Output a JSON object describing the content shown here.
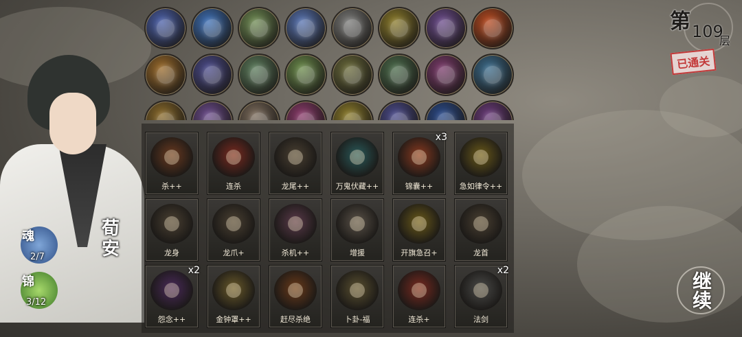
{
  "character": {
    "name": "荀安"
  },
  "stats": {
    "soul_label": "魂",
    "soul_value": "2/7",
    "bag_label": "锦",
    "bag_value": "3/12"
  },
  "floor": {
    "prefix": "第",
    "number": "109",
    "suffix": "层",
    "status": "已通关"
  },
  "continue_button": "继续",
  "relics": [
    {
      "icon": "copper-coin-icon",
      "color": "#4a5fa8"
    },
    {
      "icon": "blue-beads-icon",
      "color": "#3d6fb5"
    },
    {
      "icon": "jade-disc-icon",
      "color": "#6e8a52"
    },
    {
      "icon": "pearls-icon",
      "color": "#5672b0"
    },
    {
      "icon": "cloud-scroll-icon",
      "color": "#7a7a78"
    },
    {
      "icon": "golden-charm-icon",
      "color": "#8a7a2a"
    },
    {
      "icon": "eye-pearl-icon",
      "color": "#6a4a8a"
    },
    {
      "icon": "fire-orb-icon",
      "color": "#b84a20"
    },
    {
      "icon": "gold-bowl-icon",
      "color": "#9a6a2a"
    },
    {
      "icon": "silver-ornament-icon",
      "color": "#4a4a8a"
    },
    {
      "icon": "coin-pile-icon",
      "color": "#5a7a5a"
    },
    {
      "icon": "jade-piece-icon",
      "color": "#6a8a4a"
    },
    {
      "icon": "horn-icon",
      "color": "#6a6a3a"
    },
    {
      "icon": "stone-tablet-icon",
      "color": "#4a6a4a"
    },
    {
      "icon": "golden-staff-icon",
      "color": "#7a3a6a"
    },
    {
      "icon": "porcelain-vase-icon",
      "color": "#3a6a8a"
    },
    {
      "icon": "gold-ring-icon",
      "color": "#8a6a2a"
    },
    {
      "icon": "purple-gem-icon",
      "color": "#6a4a8a"
    },
    {
      "icon": "scroll-icon",
      "color": "#7a6a5a"
    },
    {
      "icon": "pink-flower-icon",
      "color": "#8a3a6a"
    },
    {
      "icon": "gold-coin-icon",
      "color": "#8a7a2a"
    },
    {
      "icon": "silver-wave-icon",
      "color": "#4a4a8a"
    },
    {
      "icon": "blue-flame-icon",
      "color": "#2a4a8a"
    },
    {
      "icon": "purple-coin-icon",
      "color": "#6a3a7a"
    }
  ],
  "cards": [
    {
      "name": "杀++",
      "count": "",
      "icon": "sword-slash-icon",
      "color": "#6a3a20"
    },
    {
      "name": "连杀",
      "count": "",
      "icon": "red-burst-icon",
      "color": "#7a2a20"
    },
    {
      "name": "龙尾++",
      "count": "",
      "icon": "dragon-tail-icon",
      "color": "#4a4032"
    },
    {
      "name": "万鬼伏藏++",
      "count": "",
      "icon": "ghost-wave-icon",
      "color": "#2a5a5a"
    },
    {
      "name": "锦囊++",
      "count": "x3",
      "icon": "silk-bag-icon",
      "color": "#8a3a20"
    },
    {
      "name": "急如律令++",
      "count": "",
      "icon": "talisman-icon",
      "color": "#6a5a1a"
    },
    {
      "name": "龙身",
      "count": "",
      "icon": "dragon-body-icon",
      "color": "#4a4032"
    },
    {
      "name": "龙爪+",
      "count": "",
      "icon": "dragon-claw-icon",
      "color": "#4a4032"
    },
    {
      "name": "杀机++",
      "count": "",
      "icon": "flash-blade-icon",
      "color": "#5a3a4a"
    },
    {
      "name": "增援",
      "count": "",
      "icon": "banners-icon",
      "color": "#5a5248"
    },
    {
      "name": "开旗急召+",
      "count": "",
      "icon": "gold-talisman-icon",
      "color": "#6a5a1a"
    },
    {
      "name": "龙首",
      "count": "",
      "icon": "dragon-head-icon",
      "color": "#4a4032"
    },
    {
      "name": "怨念++",
      "count": "x2",
      "icon": "vortex-icon",
      "color": "#4a2a5a"
    },
    {
      "name": "金钟罩++",
      "count": "",
      "icon": "golden-bell-icon",
      "color": "#6a5a2a"
    },
    {
      "name": "赶尽杀绝",
      "count": "",
      "icon": "fire-blast-icon",
      "color": "#6a3a1a"
    },
    {
      "name": "卜卦-福",
      "count": "",
      "icon": "fortune-icon",
      "color": "#5a5030"
    },
    {
      "name": "连杀+",
      "count": "",
      "icon": "red-burst-icon",
      "color": "#7a2a20"
    },
    {
      "name": "法剑",
      "count": "x2",
      "icon": "magic-sword-icon",
      "color": "#4a4a48"
    }
  ]
}
